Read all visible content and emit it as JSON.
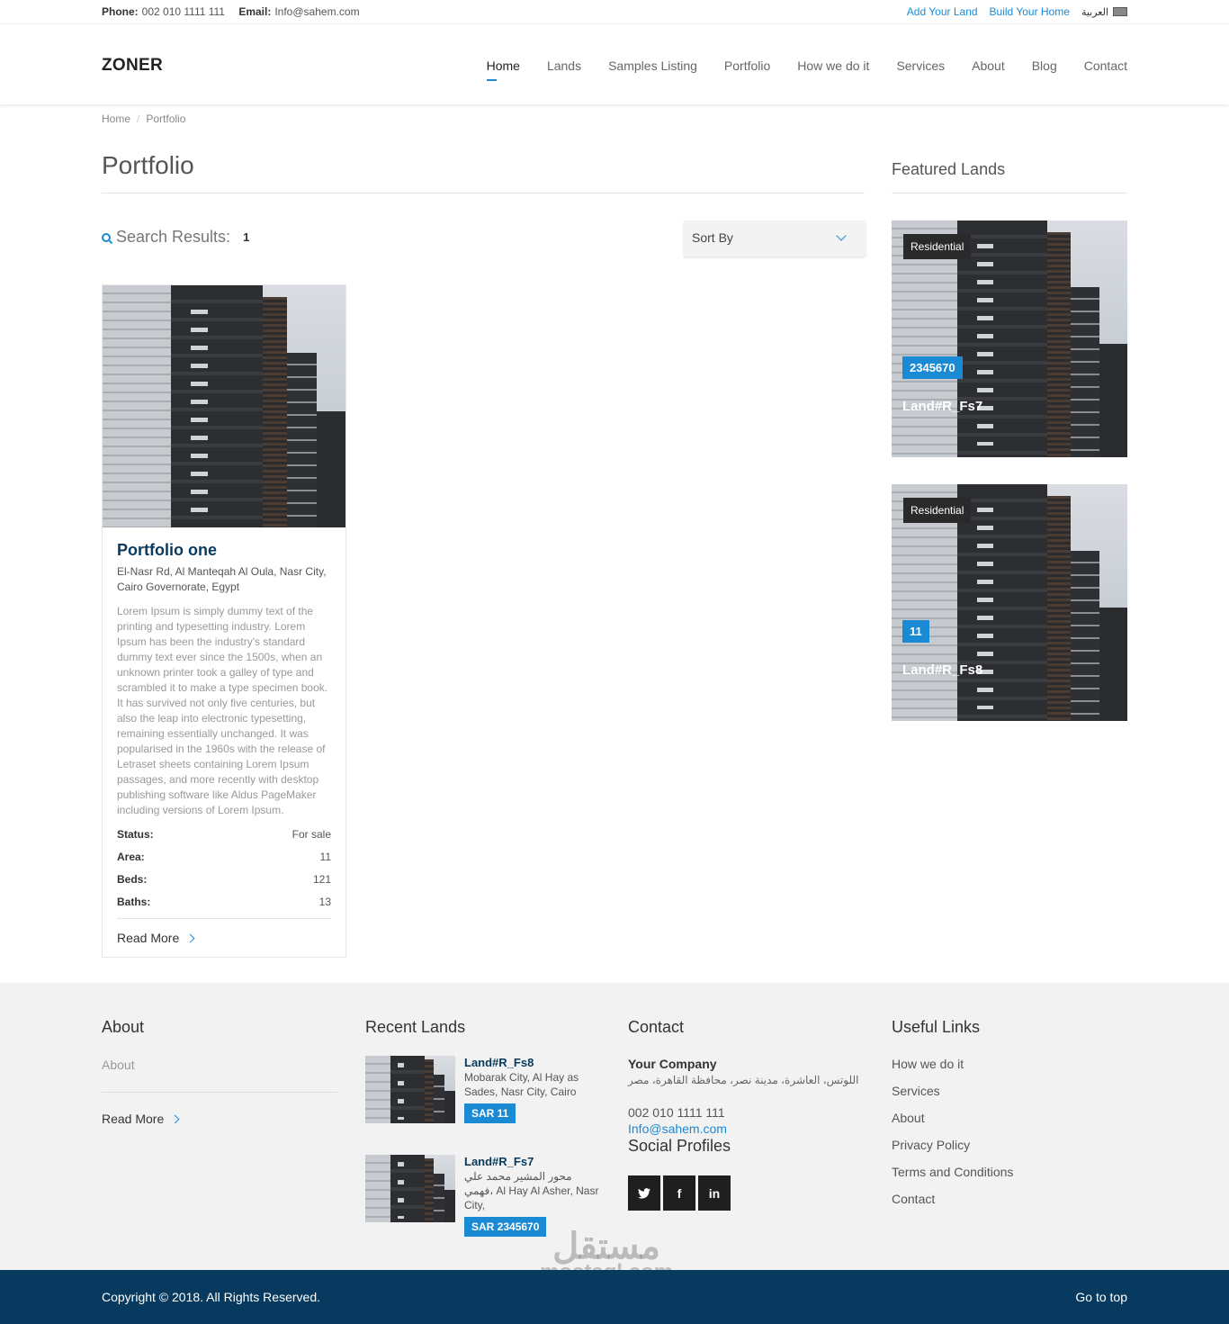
{
  "topbar": {
    "phone_label": "Phone:",
    "phone": "002 010 1111 111",
    "email_label": "Email:",
    "email": "Info@sahem.com",
    "add_land": "Add Your Land",
    "build_home": "Build Your Home",
    "language": "العربية"
  },
  "header": {
    "logo": "ZONER",
    "nav": [
      "Home",
      "Lands",
      "Samples Listing",
      "Portfolio",
      "How we do it",
      "Services",
      "About",
      "Blog",
      "Contact"
    ]
  },
  "breadcrumb": [
    "Home",
    "Portfolio"
  ],
  "page": {
    "title": "Portfolio",
    "search_label": "Search Results:",
    "search_count": "1",
    "sort_label": "Sort By"
  },
  "card": {
    "title": "Portfolio one",
    "address": "El-Nasr Rd, Al Manteqah Al Oula, Nasr City, Cairo Governorate, Egypt",
    "description": "Lorem Ipsum is simply dummy text of the printing and typesetting industry. Lorem Ipsum has been the industry's standard dummy text ever since the 1500s, when an unknown printer took a galley of type and scrambled it to make a type specimen book. It has survived not only five centuries, but also the leap into electronic typesetting, remaining essentially unchanged. It was popularised in the 1960s with the release of Letraset sheets containing Lorem Ipsum passages, and more recently with desktop publishing software like Aldus PageMaker including versions of Lorem Ipsum.",
    "meta": [
      {
        "label": "Status:",
        "value": "For sale"
      },
      {
        "label": "Area:",
        "value": "11"
      },
      {
        "label": "Beds:",
        "value": "121"
      },
      {
        "label": "Baths:",
        "value": "13"
      }
    ],
    "read_more": "Read More"
  },
  "featured": {
    "title": "Featured Lands",
    "items": [
      {
        "category": "Residential",
        "price": "2345670",
        "name": "Land#R_Fs7"
      },
      {
        "category": "Residential",
        "price": "11",
        "name": "Land#R_Fs8"
      }
    ]
  },
  "footer": {
    "about": {
      "title": "About",
      "text": "About",
      "read_more": "Read More"
    },
    "recent": {
      "title": "Recent Lands",
      "items": [
        {
          "name": "Land#R_Fs8",
          "address": "Mobarak City, Al Hay as Sades, Nasr City, Cairo",
          "price": "SAR 11"
        },
        {
          "name": "Land#R_Fs7",
          "address": "محور المشير محمد علي فهمي، Al Hay Al Asher, Nasr City,",
          "price": "SAR 2345670"
        }
      ]
    },
    "contact": {
      "title": "Contact",
      "company": "Your Company",
      "address": "اللوتس، العاشرة، مدينة نصر، محافظة القاهرة، مصر",
      "phone": "002 010 1111 111",
      "email": "Info@sahem.com",
      "social_title": "Social Profiles"
    },
    "links": {
      "title": "Useful Links",
      "items": [
        "How we do it",
        "Services",
        "About",
        "Privacy Policy",
        "Terms and Conditions",
        "Contact"
      ]
    }
  },
  "watermark": {
    "ar": "مستقل",
    "en": "mostaql.com"
  },
  "bottom": {
    "copyright": "Copyright © 2018. All Rights Reserved.",
    "go_top": "Go to top"
  }
}
